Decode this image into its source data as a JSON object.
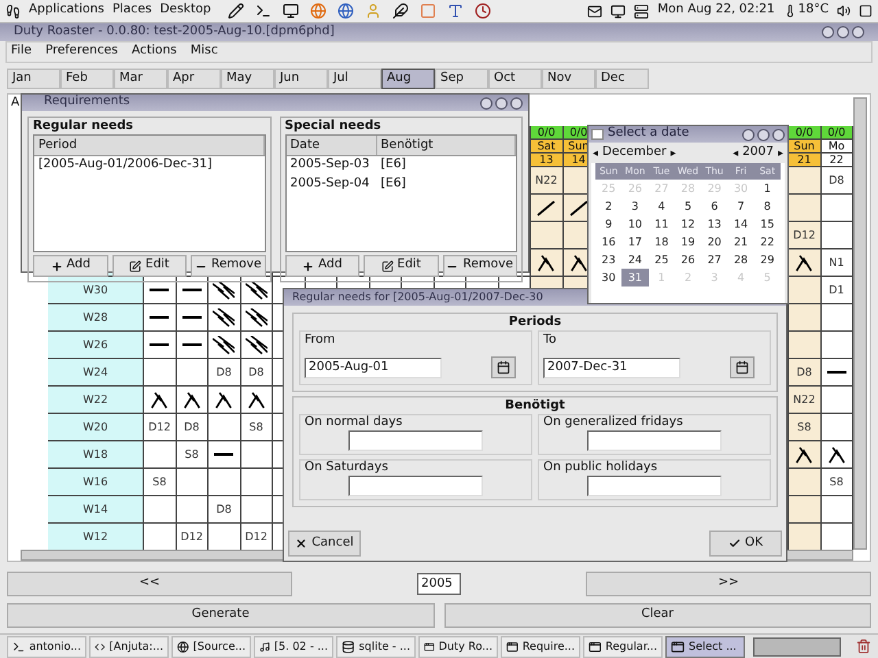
{
  "top_panel": {
    "menus": [
      "Applications",
      "Places",
      "Desktop"
    ],
    "clock": "Mon Aug 22, 02:21",
    "temperature": "18°C"
  },
  "main_window": {
    "title": "Duty Roaster - 0.0.80: test-2005-Aug-10.[dpm6phd]",
    "menu": [
      "File",
      "Preferences",
      "Actions",
      "Misc"
    ],
    "months": [
      {
        "label": "Jan",
        "selected": false
      },
      {
        "label": "Feb",
        "selected": false
      },
      {
        "label": "Mar",
        "selected": false
      },
      {
        "label": "Apr",
        "selected": false
      },
      {
        "label": "May",
        "selected": false
      },
      {
        "label": "Jun",
        "selected": false
      },
      {
        "label": "Jul",
        "selected": false
      },
      {
        "label": "Aug",
        "selected": true
      },
      {
        "label": "Sep",
        "selected": false
      },
      {
        "label": "Oct",
        "selected": false
      },
      {
        "label": "Nov",
        "selected": false
      },
      {
        "label": "Dec",
        "selected": false
      }
    ]
  },
  "grid": {
    "frame_label": "A",
    "left_block": [
      {
        "label": "W30",
        "cells": [
          {
            "kind": "dash"
          },
          {
            "kind": "dash"
          },
          {
            "kind": "hatch"
          },
          {
            "kind": "hatch"
          }
        ]
      },
      {
        "label": "W28",
        "cells": [
          {
            "kind": "dash"
          },
          {
            "kind": "dash"
          },
          {
            "kind": "hatch"
          },
          {
            "kind": "hatch"
          }
        ]
      },
      {
        "label": "W26",
        "cells": [
          {
            "kind": "dash"
          },
          {
            "kind": "dash"
          },
          {
            "kind": "hatch"
          },
          {
            "kind": "hatch"
          }
        ]
      },
      {
        "label": "W24",
        "cells": [
          {
            "kind": "blank"
          },
          {
            "kind": "blank"
          },
          {
            "kind": "text",
            "text": "D8"
          },
          {
            "kind": "text",
            "text": "D8"
          }
        ]
      },
      {
        "label": "W22",
        "cells": [
          {
            "kind": "peak"
          },
          {
            "kind": "peak"
          },
          {
            "kind": "peak"
          },
          {
            "kind": "peak"
          }
        ]
      },
      {
        "label": "W20",
        "cells": [
          {
            "kind": "text",
            "text": "D12"
          },
          {
            "kind": "text",
            "text": "D8"
          },
          {
            "kind": "blank"
          },
          {
            "kind": "text",
            "text": "S8"
          }
        ]
      },
      {
        "label": "W18",
        "cells": [
          {
            "kind": "blank"
          },
          {
            "kind": "text",
            "text": "S8"
          },
          {
            "kind": "dash"
          },
          {
            "kind": "blank"
          }
        ]
      },
      {
        "label": "W16",
        "cells": [
          {
            "kind": "text",
            "text": "S8"
          },
          {
            "kind": "blank"
          },
          {
            "kind": "blank"
          },
          {
            "kind": "blank"
          }
        ]
      },
      {
        "label": "W14",
        "cells": [
          {
            "kind": "blank"
          },
          {
            "kind": "blank"
          },
          {
            "kind": "text",
            "text": "D8"
          },
          {
            "kind": "blank"
          }
        ]
      },
      {
        "label": "W12",
        "cells": [
          {
            "kind": "blank"
          },
          {
            "kind": "text",
            "text": "D12"
          },
          {
            "kind": "blank"
          },
          {
            "kind": "text",
            "text": "D12"
          }
        ]
      }
    ],
    "day_columns": [
      {
        "count": "0/0",
        "day": "Sat",
        "date": "13",
        "weekend": true,
        "cells": [
          {
            "kind": "text",
            "text": "N22"
          },
          {
            "kind": "slash"
          },
          {
            "kind": "blank"
          },
          {
            "kind": "peak"
          },
          {
            "kind": "blank"
          }
        ]
      },
      {
        "count": "0/0",
        "day": "Sun",
        "date": "14",
        "weekend": true,
        "cells": [
          {
            "kind": "blank"
          },
          {
            "kind": "slash"
          },
          {
            "kind": "blank"
          },
          {
            "kind": "peak"
          },
          {
            "kind": "blank"
          }
        ]
      },
      {
        "count": "0/0",
        "day": "Sun",
        "date": "21",
        "weekend": true,
        "cells": [
          {
            "kind": "blank"
          },
          {
            "kind": "blank"
          },
          {
            "kind": "text",
            "text": "D12"
          },
          {
            "kind": "peak"
          },
          {
            "kind": "blank"
          },
          {
            "kind": "blank"
          },
          {
            "kind": "blank"
          },
          {
            "kind": "text",
            "text": "D8"
          },
          {
            "kind": "text",
            "text": "N22"
          },
          {
            "kind": "text",
            "text": "S8"
          },
          {
            "kind": "peak"
          },
          {
            "kind": "blank"
          },
          {
            "kind": "blank"
          },
          {
            "kind": "blank"
          }
        ]
      },
      {
        "count": "0/0",
        "day": "Mo",
        "date": "22",
        "weekend": false,
        "cells": [
          {
            "kind": "text",
            "text": "D8"
          },
          {
            "kind": "blank"
          },
          {
            "kind": "blank"
          },
          {
            "kind": "text",
            "text": "N1"
          },
          {
            "kind": "text",
            "text": "D1"
          },
          {
            "kind": "blank"
          },
          {
            "kind": "blank"
          },
          {
            "kind": "dash"
          },
          {
            "kind": "blank"
          },
          {
            "kind": "blank"
          },
          {
            "kind": "peak"
          },
          {
            "kind": "text",
            "text": "S8"
          },
          {
            "kind": "blank"
          },
          {
            "kind": "blank"
          }
        ]
      }
    ]
  },
  "year_nav": {
    "prev": "<<",
    "year": "2005",
    "next": ">>"
  },
  "actions": [
    "Generate",
    "Clear"
  ],
  "requirements": {
    "title": "Requirements",
    "regular": {
      "title": "Regular needs",
      "columns": [
        "Period"
      ],
      "rows": [
        [
          "[2005-Aug-01/2006-Dec-31]"
        ]
      ],
      "buttons": [
        "Add",
        "Edit",
        "Remove"
      ]
    },
    "special": {
      "title": "Special needs",
      "columns": [
        "Date",
        "Benötigt"
      ],
      "rows": [
        [
          "2005-Sep-03",
          "[E6]"
        ],
        [
          "2005-Sep-04",
          "[E6]"
        ]
      ],
      "buttons": [
        "Add",
        "Edit",
        "Remove"
      ]
    }
  },
  "date_picker": {
    "title": "Select a date",
    "month_prev": "◂",
    "month": "December",
    "month_next": "▸",
    "year_prev": "◂",
    "year": "2007",
    "year_next": "▸",
    "weekdays": [
      "Sun",
      "Mon",
      "Tue",
      "Wed",
      "Thu",
      "Fri",
      "Sat"
    ],
    "days": [
      {
        "d": "25",
        "other": true,
        "selected": false
      },
      {
        "d": "26",
        "other": true,
        "selected": false
      },
      {
        "d": "27",
        "other": true,
        "selected": false
      },
      {
        "d": "28",
        "other": true,
        "selected": false
      },
      {
        "d": "29",
        "other": true,
        "selected": false
      },
      {
        "d": "30",
        "other": true,
        "selected": false
      },
      {
        "d": "1",
        "other": false,
        "selected": false
      },
      {
        "d": "2",
        "other": false,
        "selected": false
      },
      {
        "d": "3",
        "other": false,
        "selected": false
      },
      {
        "d": "4",
        "other": false,
        "selected": false
      },
      {
        "d": "5",
        "other": false,
        "selected": false
      },
      {
        "d": "6",
        "other": false,
        "selected": false
      },
      {
        "d": "7",
        "other": false,
        "selected": false
      },
      {
        "d": "8",
        "other": false,
        "selected": false
      },
      {
        "d": "9",
        "other": false,
        "selected": false
      },
      {
        "d": "10",
        "other": false,
        "selected": false
      },
      {
        "d": "11",
        "other": false,
        "selected": false
      },
      {
        "d": "12",
        "other": false,
        "selected": false
      },
      {
        "d": "13",
        "other": false,
        "selected": false
      },
      {
        "d": "14",
        "other": false,
        "selected": false
      },
      {
        "d": "15",
        "other": false,
        "selected": false
      },
      {
        "d": "16",
        "other": false,
        "selected": false
      },
      {
        "d": "17",
        "other": false,
        "selected": false
      },
      {
        "d": "18",
        "other": false,
        "selected": false
      },
      {
        "d": "19",
        "other": false,
        "selected": false
      },
      {
        "d": "20",
        "other": false,
        "selected": false
      },
      {
        "d": "21",
        "other": false,
        "selected": false
      },
      {
        "d": "22",
        "other": false,
        "selected": false
      },
      {
        "d": "23",
        "other": false,
        "selected": false
      },
      {
        "d": "24",
        "other": false,
        "selected": false
      },
      {
        "d": "25",
        "other": false,
        "selected": false
      },
      {
        "d": "26",
        "other": false,
        "selected": false
      },
      {
        "d": "27",
        "other": false,
        "selected": false
      },
      {
        "d": "28",
        "other": false,
        "selected": false
      },
      {
        "d": "29",
        "other": false,
        "selected": false
      },
      {
        "d": "30",
        "other": false,
        "selected": false
      },
      {
        "d": "31",
        "other": false,
        "selected": true
      },
      {
        "d": "1",
        "other": true,
        "selected": false
      },
      {
        "d": "2",
        "other": true,
        "selected": false
      },
      {
        "d": "3",
        "other": true,
        "selected": false
      },
      {
        "d": "4",
        "other": true,
        "selected": false
      },
      {
        "d": "5",
        "other": true,
        "selected": false
      }
    ]
  },
  "regular_dialog": {
    "title": "Regular needs for [2005-Aug-01/2007-Dec-30",
    "periods": {
      "title": "Periods",
      "fields": [
        {
          "label": "From",
          "value": "2005-Aug-01"
        },
        {
          "label": "To",
          "value": "2007-Dec-31"
        }
      ]
    },
    "needs": {
      "title": "Benötigt",
      "fields": [
        {
          "label": "On normal days"
        },
        {
          "label": "On generalized fridays"
        },
        {
          "label": "On Saturdays"
        },
        {
          "label": "On public holidays"
        }
      ]
    },
    "buttons": [
      {
        "label": "Cancel",
        "kind": "cancel"
      },
      {
        "label": "OK",
        "kind": "ok"
      }
    ]
  },
  "taskbar": [
    {
      "label": "antonio...",
      "kind": "terminal",
      "selected": false
    },
    {
      "label": "[Anjuta:...",
      "kind": "editor",
      "selected": false
    },
    {
      "label": "[Source...",
      "kind": "web",
      "selected": false
    },
    {
      "label": "[5. 02 - ...",
      "kind": "media",
      "selected": false
    },
    {
      "label": "sqlite - ...",
      "kind": "database",
      "selected": false
    },
    {
      "label": "Duty Ro...",
      "kind": "window",
      "selected": false
    },
    {
      "label": "Require...",
      "kind": "window",
      "selected": false
    },
    {
      "label": "Regular...",
      "kind": "window",
      "selected": false
    },
    {
      "label": "Select ...",
      "kind": "window",
      "selected": true
    }
  ]
}
